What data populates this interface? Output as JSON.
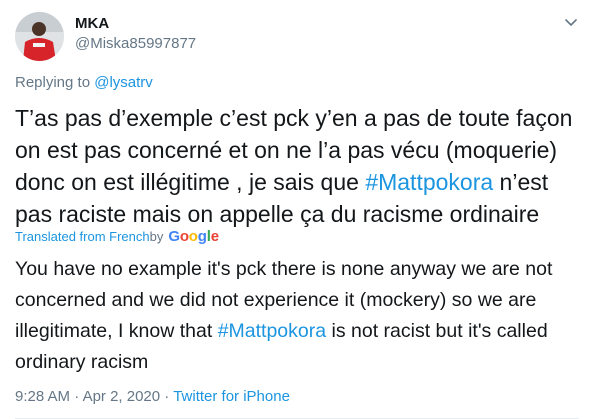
{
  "author": {
    "name": "MKA",
    "handle": "@Miska85997877"
  },
  "replying": {
    "prefix": "Replying to ",
    "mention": "@lysatrv"
  },
  "tweet": {
    "part1": "T’as pas d’exemple c’est pck y’en a pas de toute façon on est pas concerné et on ne l’a pas vécu (moquerie) donc on est illégitime , je sais que ",
    "hashtag": "#Mattpokora",
    "part2": " n’est pas raciste mais on appelle ça du racisme ordinaire"
  },
  "translation_bar": {
    "label": "Translated from French",
    "by": " by",
    "provider": "Google"
  },
  "translation": {
    "part1": "You have no example it's pck there is none anyway we are not concerned and we did not experience it (mockery) so we are illegitimate, I know that ",
    "hashtag": "#Mattpokora",
    "part2": " is not racist but it's called ordinary racism"
  },
  "meta": {
    "time": "9:28 AM",
    "separator": " · ",
    "date": "Apr 2, 2020",
    "source": "Twitter for iPhone"
  },
  "colors": {
    "link": "#1b95e0",
    "secondary_text": "#657786",
    "text": "#14171a"
  },
  "icons": {
    "menu": "chevron-down-icon"
  }
}
